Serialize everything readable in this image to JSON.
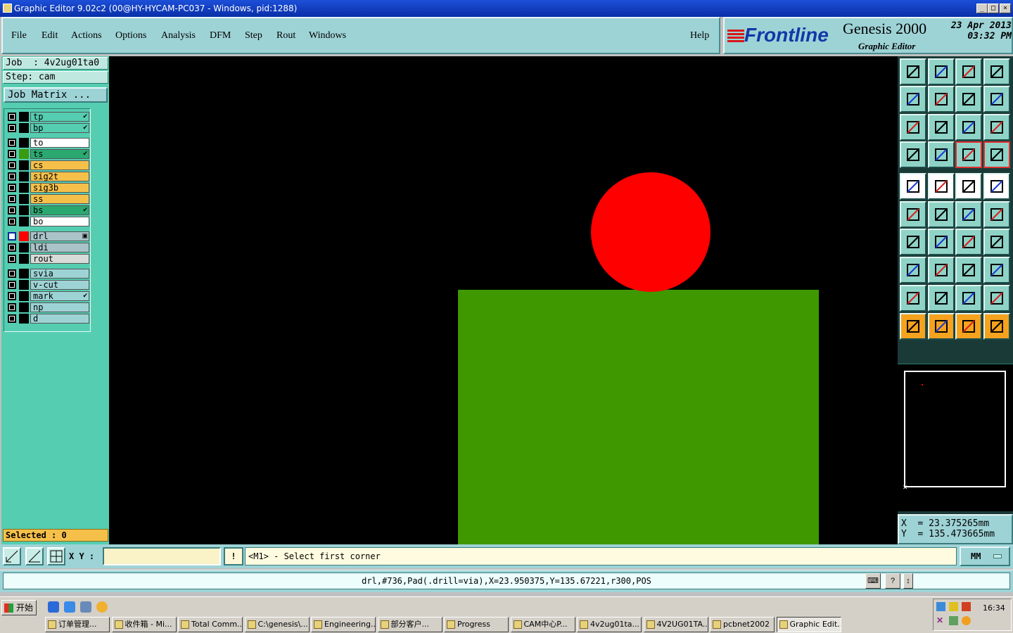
{
  "window": {
    "title": "Graphic Editor 9.02c2 (00@HY-HYCAM-PC037 - Windows, pid:1288)",
    "controls": [
      "_",
      "□",
      "×"
    ]
  },
  "menu": {
    "items": [
      "File",
      "Edit",
      "Actions",
      "Options",
      "Analysis",
      "DFM",
      "Step",
      "Rout",
      "Windows"
    ],
    "help": "Help"
  },
  "brand": {
    "logo": "Frontline",
    "product": "Genesis 2000",
    "subtitle": "Graphic Editor",
    "date": "23 Apr 2013",
    "time": "03:32 PM"
  },
  "job": {
    "job_line": "Job  : 4v2ug01ta0",
    "step_line": "Step: cam",
    "matrix_button": "Job Matrix ..."
  },
  "layers": [
    {
      "name": "tp",
      "color": "#55cdb1",
      "swatch": "#000000",
      "mark": "✔"
    },
    {
      "name": "bp",
      "color": "#55cdb1",
      "swatch": "#000000",
      "mark": "✔"
    },
    {
      "name": "to",
      "color": "#ffffff",
      "swatch": "#000000",
      "mark": ""
    },
    {
      "name": "ts",
      "color": "#2aa870",
      "swatch": "#3a9a10",
      "mark": "✔"
    },
    {
      "name": "cs",
      "color": "#f5c04a",
      "swatch": "#000000",
      "mark": ""
    },
    {
      "name": "sig2t",
      "color": "#f5c04a",
      "swatch": "#000000",
      "mark": ""
    },
    {
      "name": "sig3b",
      "color": "#f5c04a",
      "swatch": "#000000",
      "mark": ""
    },
    {
      "name": "ss",
      "color": "#f5c04a",
      "swatch": "#000000",
      "mark": ""
    },
    {
      "name": "bs",
      "color": "#2aa870",
      "swatch": "#000000",
      "mark": "✔"
    },
    {
      "name": "bo",
      "color": "#ffffff",
      "swatch": "#000000",
      "mark": ""
    },
    {
      "name": "drl",
      "color": "#a9c3c8",
      "swatch": "#ff0000",
      "mark": "▣",
      "active": true
    },
    {
      "name": "ldi",
      "color": "#a9c3c8",
      "swatch": "#000000",
      "mark": ""
    },
    {
      "name": "rout",
      "color": "#d8dcd8",
      "swatch": "#000000",
      "mark": ""
    },
    {
      "name": "svia",
      "color": "#9ed3d6",
      "swatch": "#000000",
      "mark": ""
    },
    {
      "name": "v-cut",
      "color": "#9ed3d6",
      "swatch": "#000000",
      "mark": ""
    },
    {
      "name": "mark",
      "color": "#9ed3d6",
      "swatch": "#000000",
      "mark": "✔"
    },
    {
      "name": "np",
      "color": "#9ed3d6",
      "swatch": "#000000",
      "mark": ""
    },
    {
      "name": "d",
      "color": "#9ed3d6",
      "swatch": "#000000",
      "mark": ""
    }
  ],
  "selected": "Selected : 0",
  "canvas": {
    "background": "#000000",
    "pad_color": "#ff0000",
    "rect_color": "#3f9800"
  },
  "toolbox": {
    "icons": [
      "zoom-home-icon",
      "zoom-back-icon",
      "home-icon",
      "window-icon",
      "pan-left-icon",
      "pan-right-icon",
      "undo-icon",
      "redraw-icon",
      "fit-icon",
      "center-icon",
      "scale-1-2-icon",
      "help-icon",
      "snap-tool-icon",
      "feature-icon",
      "layers-red-icon",
      "layers-red2-icon",
      "pad-icon",
      "polygon-icon",
      "ruler-icon",
      "dot-icon",
      "nodes-icon",
      "cross-icon",
      "line-icon",
      "line2-icon",
      "angle-icon",
      "diagonal-icon",
      "rotate-icon",
      "mirror-icon",
      "move-icon",
      "cut-icon",
      "measure-icon",
      "shapes-icon",
      "arc-icon",
      "arc2-icon",
      "arc3-icon",
      "arc4-icon",
      "select-icon",
      "select2-icon",
      "select3-icon",
      "select4-icon"
    ]
  },
  "coords": {
    "x": "X  = 23.375265mm",
    "y": "Y  = 135.473665mm"
  },
  "command": {
    "xy_label": "X Y :",
    "xy_value": "",
    "warn": "!",
    "prompt": "<M1> - Select first corner",
    "units": "MM"
  },
  "status": {
    "text": "drl,#736,Pad(.drill=via),X=23.950375,Y=135.67221,r300,POS"
  },
  "taskbar": {
    "start": "开始",
    "tasks": [
      "订单管理...",
      "收件箱 - Mi...",
      "Total Comm...",
      "C:\\genesis\\...",
      "Engineering...",
      "部分客户...",
      "Progress",
      "CAM中心P...",
      "4v2ug01ta...",
      "4V2UG01TA...",
      "pcbnet2002",
      "Graphic Edit..."
    ],
    "clock": "16:34"
  }
}
